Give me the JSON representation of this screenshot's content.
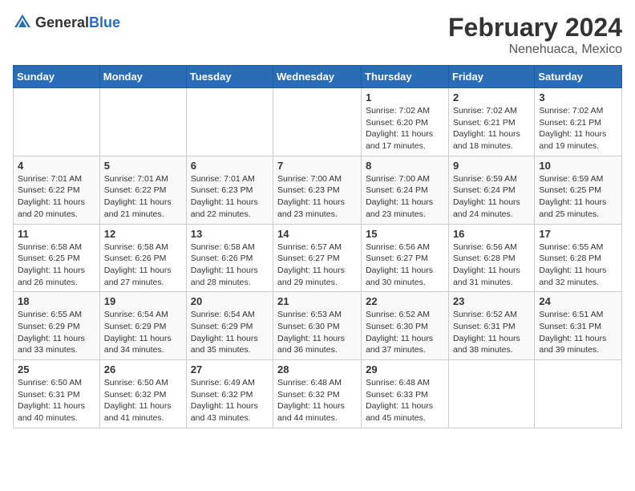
{
  "header": {
    "logo_general": "General",
    "logo_blue": "Blue",
    "title": "February 2024",
    "location": "Nenehuaca, Mexico"
  },
  "days_of_week": [
    "Sunday",
    "Monday",
    "Tuesday",
    "Wednesday",
    "Thursday",
    "Friday",
    "Saturday"
  ],
  "weeks": [
    [
      {
        "day": "",
        "info": ""
      },
      {
        "day": "",
        "info": ""
      },
      {
        "day": "",
        "info": ""
      },
      {
        "day": "",
        "info": ""
      },
      {
        "day": "1",
        "info": "Sunrise: 7:02 AM\nSunset: 6:20 PM\nDaylight: 11 hours and 17 minutes."
      },
      {
        "day": "2",
        "info": "Sunrise: 7:02 AM\nSunset: 6:21 PM\nDaylight: 11 hours and 18 minutes."
      },
      {
        "day": "3",
        "info": "Sunrise: 7:02 AM\nSunset: 6:21 PM\nDaylight: 11 hours and 19 minutes."
      }
    ],
    [
      {
        "day": "4",
        "info": "Sunrise: 7:01 AM\nSunset: 6:22 PM\nDaylight: 11 hours and 20 minutes."
      },
      {
        "day": "5",
        "info": "Sunrise: 7:01 AM\nSunset: 6:22 PM\nDaylight: 11 hours and 21 minutes."
      },
      {
        "day": "6",
        "info": "Sunrise: 7:01 AM\nSunset: 6:23 PM\nDaylight: 11 hours and 22 minutes."
      },
      {
        "day": "7",
        "info": "Sunrise: 7:00 AM\nSunset: 6:23 PM\nDaylight: 11 hours and 23 minutes."
      },
      {
        "day": "8",
        "info": "Sunrise: 7:00 AM\nSunset: 6:24 PM\nDaylight: 11 hours and 23 minutes."
      },
      {
        "day": "9",
        "info": "Sunrise: 6:59 AM\nSunset: 6:24 PM\nDaylight: 11 hours and 24 minutes."
      },
      {
        "day": "10",
        "info": "Sunrise: 6:59 AM\nSunset: 6:25 PM\nDaylight: 11 hours and 25 minutes."
      }
    ],
    [
      {
        "day": "11",
        "info": "Sunrise: 6:58 AM\nSunset: 6:25 PM\nDaylight: 11 hours and 26 minutes."
      },
      {
        "day": "12",
        "info": "Sunrise: 6:58 AM\nSunset: 6:26 PM\nDaylight: 11 hours and 27 minutes."
      },
      {
        "day": "13",
        "info": "Sunrise: 6:58 AM\nSunset: 6:26 PM\nDaylight: 11 hours and 28 minutes."
      },
      {
        "day": "14",
        "info": "Sunrise: 6:57 AM\nSunset: 6:27 PM\nDaylight: 11 hours and 29 minutes."
      },
      {
        "day": "15",
        "info": "Sunrise: 6:56 AM\nSunset: 6:27 PM\nDaylight: 11 hours and 30 minutes."
      },
      {
        "day": "16",
        "info": "Sunrise: 6:56 AM\nSunset: 6:28 PM\nDaylight: 11 hours and 31 minutes."
      },
      {
        "day": "17",
        "info": "Sunrise: 6:55 AM\nSunset: 6:28 PM\nDaylight: 11 hours and 32 minutes."
      }
    ],
    [
      {
        "day": "18",
        "info": "Sunrise: 6:55 AM\nSunset: 6:29 PM\nDaylight: 11 hours and 33 minutes."
      },
      {
        "day": "19",
        "info": "Sunrise: 6:54 AM\nSunset: 6:29 PM\nDaylight: 11 hours and 34 minutes."
      },
      {
        "day": "20",
        "info": "Sunrise: 6:54 AM\nSunset: 6:29 PM\nDaylight: 11 hours and 35 minutes."
      },
      {
        "day": "21",
        "info": "Sunrise: 6:53 AM\nSunset: 6:30 PM\nDaylight: 11 hours and 36 minutes."
      },
      {
        "day": "22",
        "info": "Sunrise: 6:52 AM\nSunset: 6:30 PM\nDaylight: 11 hours and 37 minutes."
      },
      {
        "day": "23",
        "info": "Sunrise: 6:52 AM\nSunset: 6:31 PM\nDaylight: 11 hours and 38 minutes."
      },
      {
        "day": "24",
        "info": "Sunrise: 6:51 AM\nSunset: 6:31 PM\nDaylight: 11 hours and 39 minutes."
      }
    ],
    [
      {
        "day": "25",
        "info": "Sunrise: 6:50 AM\nSunset: 6:31 PM\nDaylight: 11 hours and 40 minutes."
      },
      {
        "day": "26",
        "info": "Sunrise: 6:50 AM\nSunset: 6:32 PM\nDaylight: 11 hours and 41 minutes."
      },
      {
        "day": "27",
        "info": "Sunrise: 6:49 AM\nSunset: 6:32 PM\nDaylight: 11 hours and 43 minutes."
      },
      {
        "day": "28",
        "info": "Sunrise: 6:48 AM\nSunset: 6:32 PM\nDaylight: 11 hours and 44 minutes."
      },
      {
        "day": "29",
        "info": "Sunrise: 6:48 AM\nSunset: 6:33 PM\nDaylight: 11 hours and 45 minutes."
      },
      {
        "day": "",
        "info": ""
      },
      {
        "day": "",
        "info": ""
      }
    ]
  ]
}
